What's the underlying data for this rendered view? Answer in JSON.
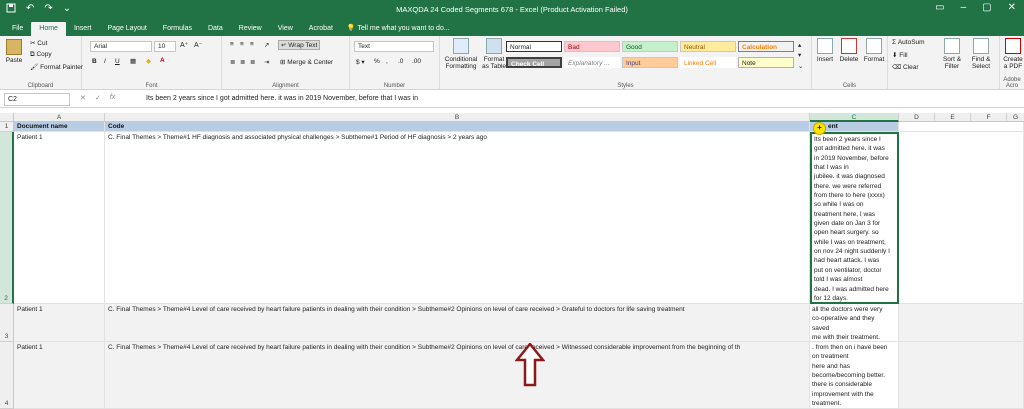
{
  "titlebar": {
    "title": "MAXQDA 24 Coded Segments 678 - Excel (Product Activation Failed)",
    "qat_icons": [
      "save-icon",
      "undo-icon",
      "redo-icon",
      "customize-icon"
    ]
  },
  "tabs": [
    "File",
    "Home",
    "Insert",
    "Page Layout",
    "Formulas",
    "Data",
    "Review",
    "View",
    "Acrobat"
  ],
  "active_tab": "Home",
  "tell_me": "Tell me what you want to do...",
  "ribbon": {
    "clipboard": {
      "paste": "Paste",
      "cut": "Cut",
      "copy": "Copy",
      "format_painter": "Format Painter",
      "label": "Clipboard"
    },
    "font": {
      "name": "Arial",
      "size": "10",
      "label": "Font"
    },
    "alignment": {
      "wrap": "Wrap Text",
      "merge": "Merge & Center",
      "label": "Alignment"
    },
    "number": {
      "format": "Text",
      "label": "Number"
    },
    "styles": {
      "conditional": "Conditional Formatting",
      "format_table": "Format as Table",
      "cells": [
        "Normal",
        "Bad",
        "Good",
        "Neutral",
        "Calculation",
        "Check Cell",
        "Explanatory ...",
        "Input",
        "Linked Cell",
        "Note"
      ],
      "label": "Styles"
    },
    "cells": {
      "insert": "Insert",
      "delete": "Delete",
      "format": "Format",
      "label": "Cells"
    },
    "editing": {
      "autosum": "AutoSum",
      "fill": "Fill",
      "clear": "Clear",
      "sort": "Sort & Filter",
      "find": "Find & Select",
      "label": "Editing"
    },
    "adobe": {
      "create": "Create a PDF",
      "label": "Adobe Acro"
    }
  },
  "formula_bar": {
    "name_box": "C2",
    "fx": "fx",
    "content": "Its been 2 years since I got admitted here. it was in 2019 November, before that I was in"
  },
  "grid": {
    "columns": [
      "A",
      "B",
      "C",
      "D",
      "E",
      "F",
      "G"
    ],
    "rows": [
      "1",
      "2",
      "3",
      "4"
    ],
    "header": {
      "a": "Document name",
      "b": "Code",
      "c": "ent"
    },
    "r2": {
      "a": "Patient 1",
      "b": "C. Final Themes > Theme#1 HF diagnosis and associated physical challenges > Subtheme#1 Period of HF diagnosis > 2 years ago",
      "c": "Its been 2 years since I\ngot admitted here. it was\nin 2019 November, before\nthat I was in\njubilee. it was diagnosed\nthere. we were referred\nfrom there to here (xxxx)\nso while I was on\ntreatment here, I was\ngiven date on Jan 3 for\nopen heart surgery. so\nwhile I was on treatment,\non nov 24 night suddenly I\nhad heart attack. I was\nput on ventilator, doctor\ntold I was almost\ndead. I was admitted here\nfor 12 days."
    },
    "r3": {
      "a": "Patient 1",
      "b": "C. Final Themes > Theme#4 Level of care received  by heart failure patients in  dealing with their condition > Subtheme#2 Opinions on level of care received > Grateful to doctors for life saving treatment",
      "c": "all the doctors were very\nco-operative and they\nsaved\nme with their treatment."
    },
    "r4": {
      "a": "Patient 1",
      "b": "C. Final Themes > Theme#4 Level of care received  by heart failure patients in  dealing with their condition > Subtheme#2 Opinions on level of care received > Witnessed considerable improvement from the beginning of th",
      "c": ". from then on i have been\non treatment\nhere and has\nbecome/becoming better.\nthere is considerable\nimprovement with the\ntreatment."
    }
  },
  "colors": {
    "excel_green": "#217346",
    "header_fill": "#b8cce4",
    "arrow": "#8b1a1a"
  }
}
